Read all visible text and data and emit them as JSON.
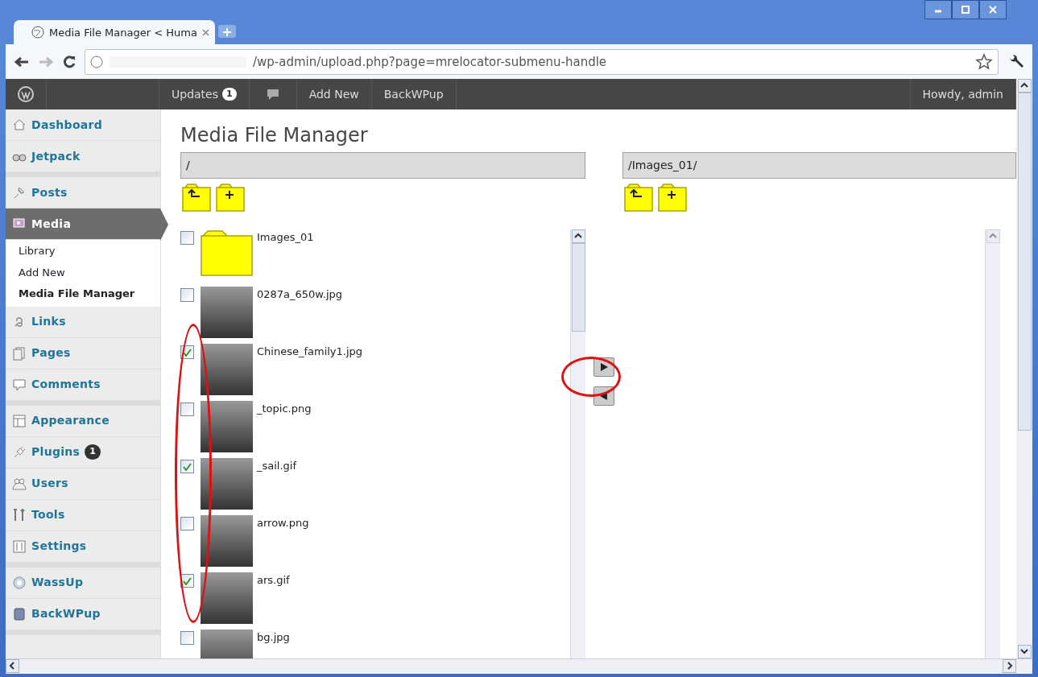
{
  "browser": {
    "tab_title": "Media File Manager < Huma",
    "url": "/wp-admin/upload.php?page=mrelocator-submenu-handle"
  },
  "admin_bar": {
    "items": [
      {
        "kind": "text",
        "label": "Updates",
        "badge": "1"
      },
      {
        "kind": "comments"
      },
      {
        "kind": "text",
        "label": "Add New"
      },
      {
        "kind": "text",
        "label": "BackWPup"
      }
    ],
    "account": "Howdy, admin"
  },
  "sidebar": {
    "groups": [
      [
        {
          "label": "Dashboard",
          "selected": false
        },
        {
          "label": "Jetpack",
          "selected": false
        }
      ],
      [
        {
          "label": "Posts",
          "selected": false
        },
        {
          "label": "Media",
          "selected": true,
          "children": [
            {
              "label": "Library",
              "selected": false
            },
            {
              "label": "Add New",
              "selected": false
            },
            {
              "label": "Media File Manager",
              "selected": true
            }
          ]
        },
        {
          "label": "Links",
          "selected": false
        },
        {
          "label": "Pages",
          "selected": false
        },
        {
          "label": "Comments",
          "selected": false
        }
      ],
      [
        {
          "label": "Appearance",
          "selected": false
        },
        {
          "label": "Plugins",
          "badge": "1",
          "selected": false
        },
        {
          "label": "Users",
          "selected": false
        },
        {
          "label": "Tools",
          "selected": false
        },
        {
          "label": "Settings",
          "selected": false
        }
      ],
      [
        {
          "label": "WassUp",
          "selected": false
        },
        {
          "label": "BackWPup",
          "selected": false
        }
      ]
    ]
  },
  "page_title": "Media File Manager",
  "left_pane": {
    "path": "/",
    "files": [
      {
        "kind": "folder",
        "name": "Images_01",
        "checked": false
      },
      {
        "kind": "image",
        "name": "0287a_650w.jpg",
        "checked": false
      },
      {
        "kind": "image",
        "name": "Chinese_family1.jpg",
        "checked": true
      },
      {
        "kind": "image",
        "name": "_topic.png",
        "checked": false
      },
      {
        "kind": "image",
        "name": "_sail.gif",
        "checked": true
      },
      {
        "kind": "image",
        "name": "arrow.png",
        "checked": false
      },
      {
        "kind": "image",
        "name": "ars.gif",
        "checked": true
      },
      {
        "kind": "image",
        "name": "bg.jpg",
        "checked": false
      }
    ]
  },
  "right_pane": {
    "path": "/Images_01/"
  },
  "annotations": {
    "checkboxes_circled": true,
    "move_right_circled": true
  }
}
